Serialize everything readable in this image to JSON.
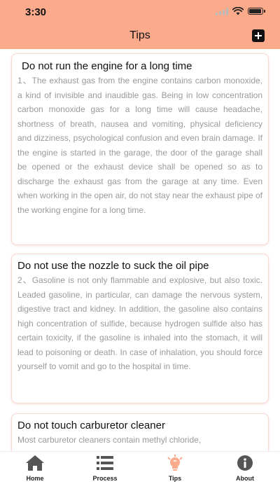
{
  "status_bar": {
    "time": "3:30"
  },
  "header": {
    "title": "Tips",
    "add_icon": "plus-square-icon"
  },
  "tips": [
    {
      "title": "Do not run the engine for a long time",
      "body": "1、The exhaust gas from the engine contains carbon monoxide, a kind of invisible and inaudible gas. Being in low concentration carbon monoxide gas for a long time will cause headache, shortness of breath, nausea and vomiting, physical deficiency and dizziness, psychological confusion and even brain damage. If the engine is started in the garage, the door of the garage shall be opened or the exhaust device shall be opened so as to discharge the exhaust gas from the garage at any time. Even when working in the open air, do not stay near the exhaust pipe of the working engine for a long time."
    },
    {
      "title": "Do not use the nozzle to suck the oil pipe",
      "body": "2、Gasoline is not only flammable and explosive, but also toxic. Leaded gasoline, in particular, can damage the nervous system, digestive tract and kidney. In addition, the gasoline also contains high concentration of sulfide, because hydrogen sulfide also has certain toxicity, if the gasoline is inhaled into the stomach, it will lead to poisoning or death. In case of inhalation, you should force yourself to vomit and go to the hospital in time."
    },
    {
      "title": "Do not touch carburetor cleaner",
      "body": "Most carburetor cleaners contain methyl chloride,"
    }
  ],
  "tab_bar": {
    "active": "Tips",
    "active_color": "#fcaa8c",
    "items": [
      {
        "label": "Home",
        "icon": "home-icon"
      },
      {
        "label": "Process",
        "icon": "list-icon"
      },
      {
        "label": "Tips",
        "icon": "lightbulb-icon"
      },
      {
        "label": "About",
        "icon": "info-icon"
      }
    ]
  },
  "colors": {
    "header_bg": "#fcaa8c",
    "body_text": "#9a9a9a",
    "card_border": "#f8d8d3"
  }
}
